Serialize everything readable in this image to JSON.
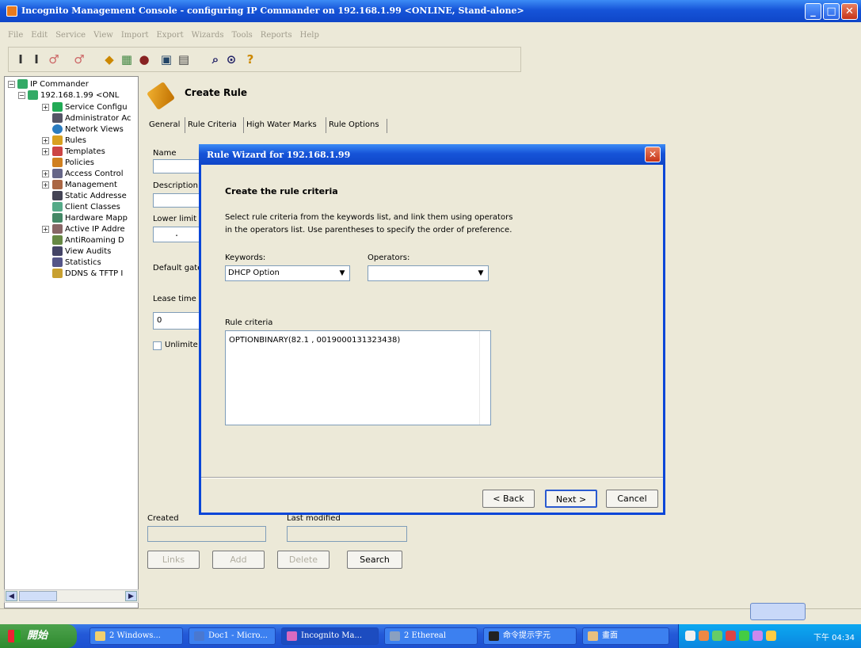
{
  "window": {
    "title": "Incognito Management Console - configuring IP Commander on 192.168.1.99 <ONLINE, Stand-alone>",
    "minimize": "_",
    "maximize": "□",
    "close": "✕"
  },
  "menu": [
    "File",
    "Edit",
    "Service",
    "View",
    "Import",
    "Export",
    "Wizards",
    "Tools",
    "Reports",
    "Help"
  ],
  "tree": {
    "root": "IP Commander",
    "server": "192.168.1.99 <ONL",
    "items": [
      "Service Configu",
      "Administrator Ac",
      "Network Views",
      "Rules",
      "Templates",
      "Policies",
      "Access Control",
      "Management",
      "Static Addresse",
      "Client Classes",
      "Hardware Mapp",
      "Active IP Addre",
      "AntiRoaming D",
      "View Audits",
      "Statistics",
      "DDNS & TFTP I"
    ]
  },
  "page": {
    "title": "Create Rule",
    "tabs": [
      "General",
      "Rule Criteria",
      "High Water Marks",
      "Rule Options"
    ],
    "name_label": "Name",
    "description_label": "Description",
    "lower_limit_label": "Lower limit",
    "lower_limit_value": ".",
    "default_gateway_label": "Default gate",
    "lease_time_label": "Lease time",
    "lease_time_value": "0",
    "unlimited_label": "Unlimite",
    "created_label": "Created",
    "last_modified_label": "Last modified",
    "buttons": {
      "links": "Links",
      "add": "Add",
      "delete": "Delete",
      "search": "Search"
    }
  },
  "dialog": {
    "title": "Rule Wizard for 192.168.1.99",
    "heading": "Create the rule criteria",
    "description": "Select rule criteria from the keywords list, and link them using operators in the operators list. Use parentheses to specify the order of preference.",
    "keywords_label": "Keywords:",
    "keywords_value": "DHCP Option",
    "operators_label": "Operators:",
    "operators_value": "",
    "criteria_label": "Rule criteria",
    "criteria_value": "OPTIONBINARY(82.1 , 0019000131323438)",
    "back": "< Back",
    "next": "Next >",
    "cancel": "Cancel"
  },
  "taskbar": {
    "start": "開始",
    "tasks": [
      "2 Windows...",
      "Doc1 - Micro...",
      "Incognito Ma...",
      "2 Ethereal",
      "命令提示字元",
      "畫面"
    ],
    "clock": "下午 04:34"
  }
}
